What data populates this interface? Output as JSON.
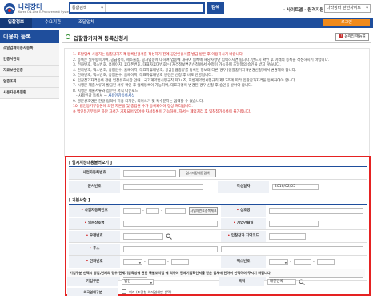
{
  "header": {
    "logo_main": "나라장터",
    "logo_sub": "Korea ON-Line E-Procurement System",
    "logo_sub_kr": "국가종합전자조달",
    "search_scope": "통합검색",
    "search_button": "검색",
    "sitemap": "· 사이트맵 · 원격지원",
    "related_sites": "나라장터 관련사이트"
  },
  "nav": {
    "home": "입찰정보",
    "items": [
      "수요기관",
      "조달업체"
    ],
    "login": "로그인"
  },
  "sidebar": {
    "heading": "이용자 등록",
    "items": [
      "조달업체이용자등록",
      "인증서관리",
      "자료보안인증",
      "업종조회",
      "사용자등록현황"
    ]
  },
  "main": {
    "title": "입찰참가자격 등록신청서",
    "help_button": "온라인 매뉴얼",
    "help_icon": "question-icon",
    "notices": [
      {
        "text": "1. 조달업체 사용자는 입찰참가자격 등록신청서를 작성하기 전에 공인인증서를 발급 받은 후 이용하시기 바랍니다.",
        "style": "red"
      },
      {
        "text": "2. 등록은 필수항목이며, 공급품목, 제조물품, 공사업종에 대하여 업종에 대하여 업체에 해당사항만 입력하시면 됩니다. 반드시 확인 후 아래의 등록을 작성하시기 바랍니다.",
        "style": "normal"
      },
      {
        "text": "3. 전화번호, 팩스번호, 홈페이지, 휴대폰번호, 대표자휴대번호는 [자격정보변경신청]에서 수정이 가능하며 조달청의 승인을 받지 않습니다.",
        "style": "normal"
      },
      {
        "text": "4. 전화번호, 팩스번호, 종업원수, 홈페이지, 대표자휴대번호, 공급물품종류를 등록된 정보와 다른 경우 [입찰참가자격변경신청]에서 변경해야 합니다.",
        "style": "normal"
      },
      {
        "text": "5. 전화번호, 팩스번호, 종업원수, 홈페이지, 대표자휴대번호 변경은 신청 후 바로 반영됩니다.",
        "style": "normal"
      },
      {
        "text": "6. 입찰참가자격등록 관련 입찰유효시장 안내 : 국가계약법시행규칙 제14조, 지방계약법시행규칙 제12조에 따라 입찰참가자격을 등록하여야 합니다.",
        "style": "normal"
      },
      {
        "text": "7. 시행문 제출서류와 발급된 서류 확인 후 업체등록이 가능하며, 대표자명이 변경된 경우 신청 후 승인을 받아야 합니다.",
        "style": "normal"
      },
      {
        "text": "8. 시행문 제출서류와 첨부된 서식 다운로드",
        "style": "normal"
      },
      {
        "text": "- 사용인감 등록서 → ",
        "link": "사용인감등록서식",
        "style": "indent"
      },
      {
        "text": "9. 영문상호명은 한글 입력이 허용 되지만, 띄어쓰기 및 특수문자는 입력할 수 없습니다.",
        "style": "normal"
      },
      {
        "text": "10. 법인등기부등본에 의한 자본금 및 종업원 수가 등록되어야 정상 처리됩니다.",
        "style": "red"
      },
      {
        "text": "※ 법인등기부등본 하단 자서가 기재되어 있어야 자서등록이 가능하며, 자서는 폐업처리 후 입찰참가등록이 불가합니다.",
        "style": "red"
      }
    ]
  },
  "form": {
    "temp_section": "[ 임시저장내용불러오기 ]",
    "biz_no_label": "사업자등록번호",
    "temp_load_button": "임시저장내용검색",
    "doc_no_label": "문서번호",
    "write_date_label": "작성일자",
    "write_date_value": "2016/02/05",
    "basic_section": "[ 기본사항 ]",
    "biz_no2_label": "사업자등록번호",
    "biz_check_button": "사업자번호중복체크",
    "company_label": "상호명",
    "eng_company_label": "영문상호명",
    "open_date_label": "개업년월일",
    "zip_label": "우편번호",
    "region_label": "입찰참가 지역코드",
    "address_label": "주소",
    "tel_label": "전화번호",
    "fax_label": "팩스번호",
    "employees_label": "종업원수",
    "employees_unit": "명",
    "homepage_label": "홈페이지",
    "corp_type_label": "기업구분",
    "corp_type_value": "법인",
    "nation_label": "국적",
    "nation_value": "대한민국",
    "corp_note": "기업구분 선택시 영업,면제의 경우 면제기업육성에 관한 특별조치법 에 의하여 면제기업확인서를 받은 업체에 한하여 선택하여 주시기 바랍니다.",
    "foreign_label": "외국업체구분",
    "foreign_check_label": "외자 (조달청 외자업체만 선택)"
  }
}
